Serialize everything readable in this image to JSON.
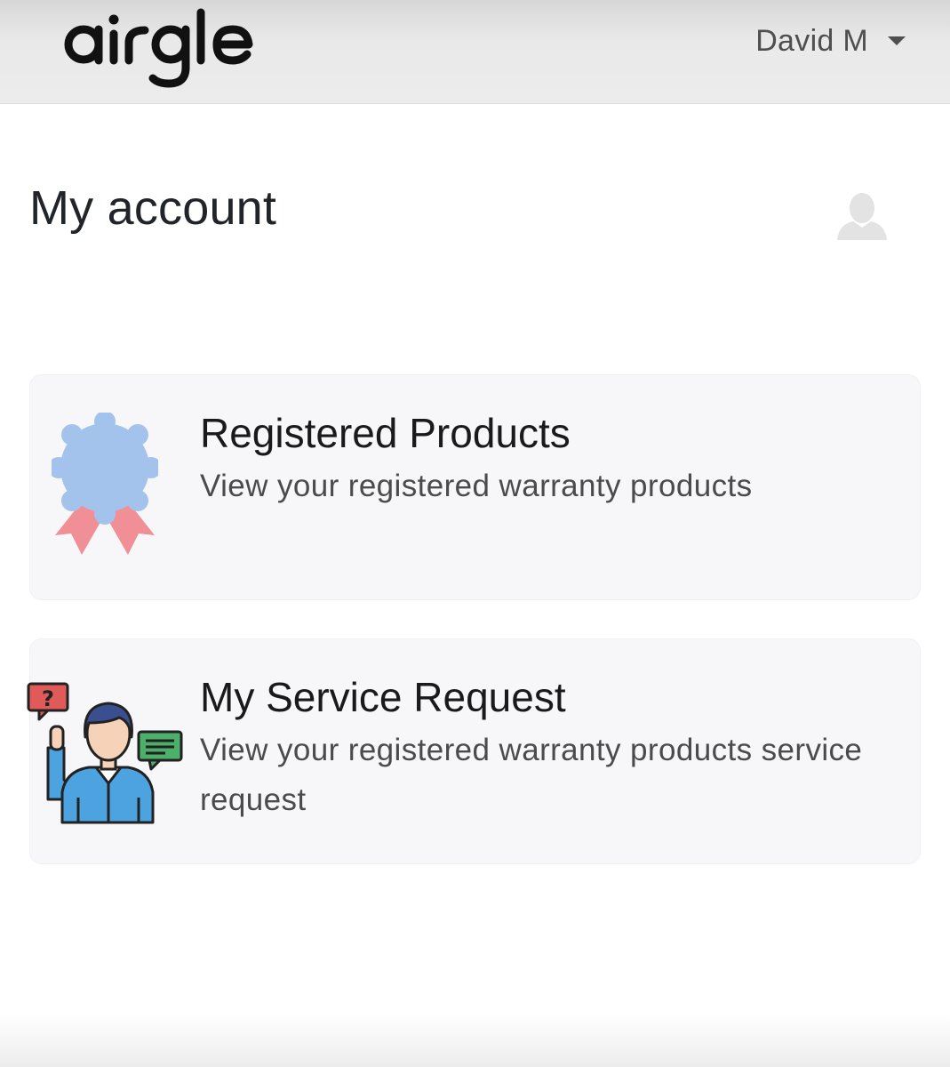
{
  "header": {
    "logo_text": "airgle",
    "user_name": "David M"
  },
  "page": {
    "title": "My account"
  },
  "cards": [
    {
      "title": "Registered Products",
      "description": "View your registered warranty products",
      "icon": "award-ribbon-icon"
    },
    {
      "title": "My Service Request",
      "description": "View your registered warranty products service request",
      "icon": "support-agent-icon"
    }
  ],
  "colors": {
    "header_bg": "#e8e8e8",
    "card_bg": "#f7f7f9",
    "rosette_blue": "#a4c3ec",
    "ribbon_pink": "#f08f96"
  }
}
